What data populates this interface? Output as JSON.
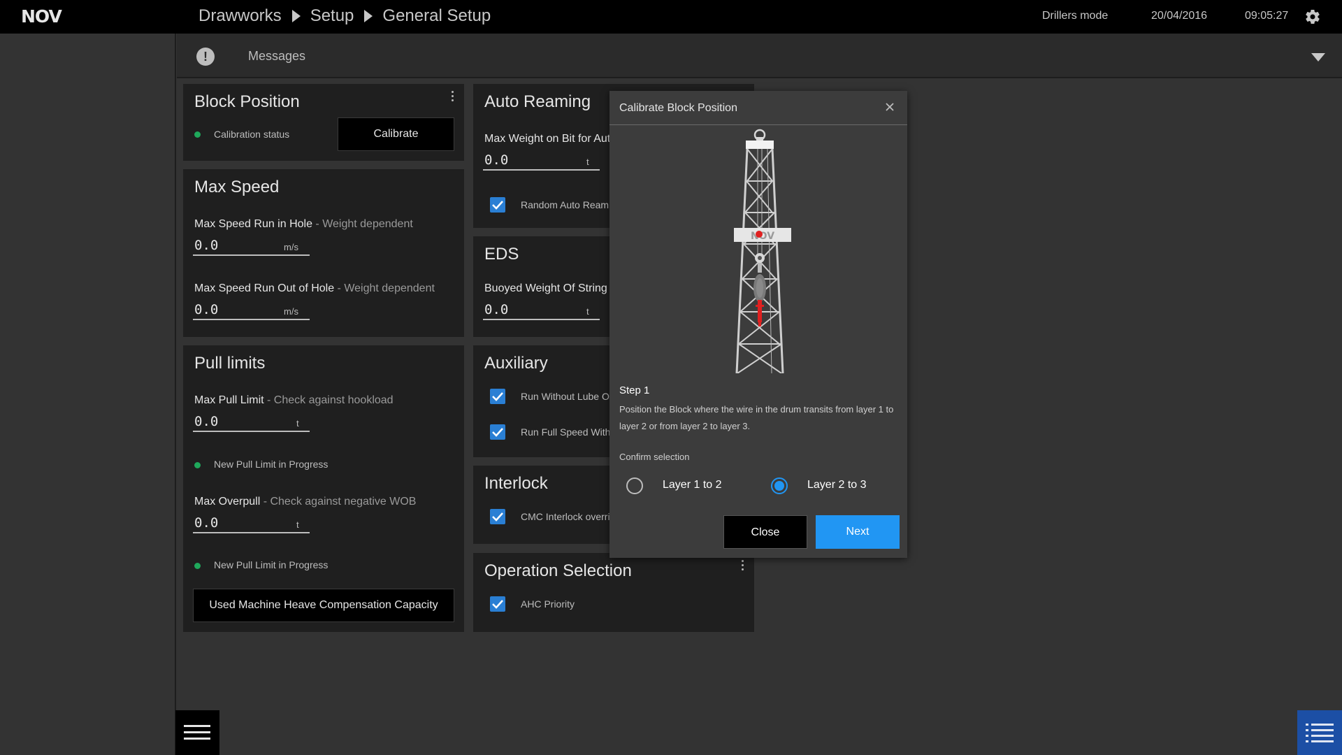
{
  "header": {
    "logo_text": "NOV",
    "breadcrumb": [
      "Drawworks",
      "Setup",
      "General Setup"
    ],
    "mode": "Drillers mode",
    "date": "20/04/2016",
    "time": "09:05:27"
  },
  "messages": {
    "icon": "!",
    "label": "Messages"
  },
  "block_position": {
    "title": "Block Position",
    "status_label": "Calibration status",
    "calibrate_button": "Calibrate"
  },
  "max_speed": {
    "title": "Max Speed",
    "run_in_label": "Max Speed Run in Hole",
    "run_in_hint": " - Weight dependent",
    "run_in_value": "0.0",
    "run_in_unit": "m/s",
    "run_out_label": "Max Speed Run Out of Hole",
    "run_out_hint": " - Weight dependent",
    "run_out_value": "0.0",
    "run_out_unit": "m/s"
  },
  "pull_limits": {
    "title": "Pull limits",
    "max_pull_label": "Max Pull Limit",
    "max_pull_hint": " - Check against hookload",
    "max_pull_value": "0.0",
    "max_pull_unit": "t",
    "progress_1": "New Pull Limit in Progress",
    "overpull_label": "Max Overpull",
    "overpull_hint": " - Check against negative WOB",
    "overpull_value": "0.0",
    "overpull_unit": "t",
    "progress_2": "New Pull Limit in Progress",
    "heave_button": "Used Machine Heave Compensation Capacity"
  },
  "auto_reaming": {
    "title": "Auto Reaming",
    "wob_label": "Max Weight on Bit for Aut",
    "wob_value": "0.0",
    "wob_unit": "t",
    "random_label": "Random Auto Reami"
  },
  "eds": {
    "title": "EDS",
    "buoyed_label": "Buoyed Weight Of String I",
    "buoyed_value": "0.0",
    "buoyed_unit": "t"
  },
  "auxiliary": {
    "title": "Auxiliary",
    "lube_label": "Run Without Lube Oi",
    "fullspeed_label": "Run Full Speed With"
  },
  "interlock": {
    "title": "Interlock",
    "cmc_label": "CMC Interlock overri"
  },
  "operation_selection": {
    "title": "Operation Selection",
    "ahc_label": "AHC Priority"
  },
  "dialog": {
    "title": "Calibrate Block Position",
    "rig_logo": "NOV",
    "step_title": "Step 1",
    "step_text": "Position the Block where the wire in the drum transits from layer 1 to layer 2 or from layer 2 to layer 3.",
    "confirm_label": "Confirm selection",
    "option_1": "Layer 1 to 2",
    "option_2": "Layer 2 to 3",
    "selected": "Layer 2 to 3",
    "close_button": "Close",
    "next_button": "Next"
  },
  "colors": {
    "accent_blue": "#2196f3",
    "status_green": "#1fa85b",
    "checkbox_blue": "#2a7fd4",
    "block_red": "#e02020"
  }
}
